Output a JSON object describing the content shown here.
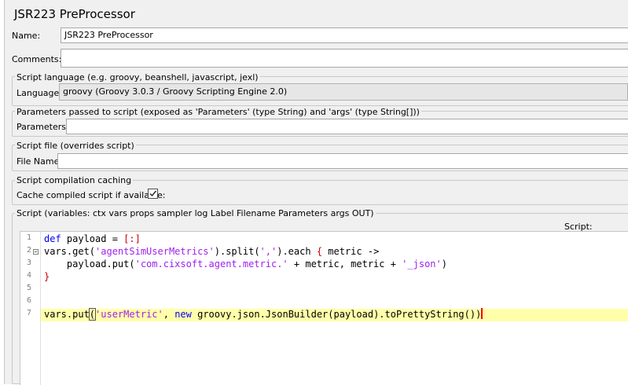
{
  "title": "JSR223 PreProcessor",
  "name_label": "Name:",
  "name_value": "JSR223 PreProcessor",
  "comments_label": "Comments:",
  "comments_value": "",
  "script_language": {
    "group_title": "Script language (e.g. groovy, beanshell, javascript, jexl)",
    "label": "Language:",
    "value": "groovy     (Groovy 3.0.3 / Groovy Scripting Engine 2.0)"
  },
  "parameters": {
    "group_title": "Parameters passed to script (exposed as 'Parameters' (type String) and 'args' (type String[]))",
    "label": "Parameters:",
    "value": ""
  },
  "script_file": {
    "group_title": "Script file (overrides script)",
    "label": "File Name:",
    "value": ""
  },
  "caching": {
    "group_title": "Script compilation caching",
    "label": "Cache compiled script if available:",
    "checked": true
  },
  "script": {
    "group_title": "Script (variables: ctx vars props sampler log Label Filename Parameters args OUT)",
    "label": "Script:",
    "line_numbers": [
      "1",
      "2",
      "3",
      "4",
      "5",
      "6",
      "7"
    ],
    "lines": {
      "l1_kw": "def",
      "l1_rest": " payload = ",
      "l1_br": "[:]",
      "l2_a": "vars.get(",
      "l2_str": "'agentSimUserMetrics'",
      "l2_b": ").split(",
      "l2_str2": "','",
      "l2_c": ").each ",
      "l2_br": "{",
      "l2_d": " metric ->",
      "l3_a": "    payload.put(",
      "l3_str": "'com.cixsoft.agent.metric.'",
      "l3_b": " + metric, metric + ",
      "l3_str2": "'_json'",
      "l3_c": ")",
      "l4": "}",
      "l7_a": "vars.put",
      "l7_paren": "(",
      "l7_str": "'userMetric'",
      "l7_b": ", ",
      "l7_kw": "new",
      "l7_c": " groovy.json.JsonBuilder(payload).toPrettyString())"
    }
  }
}
